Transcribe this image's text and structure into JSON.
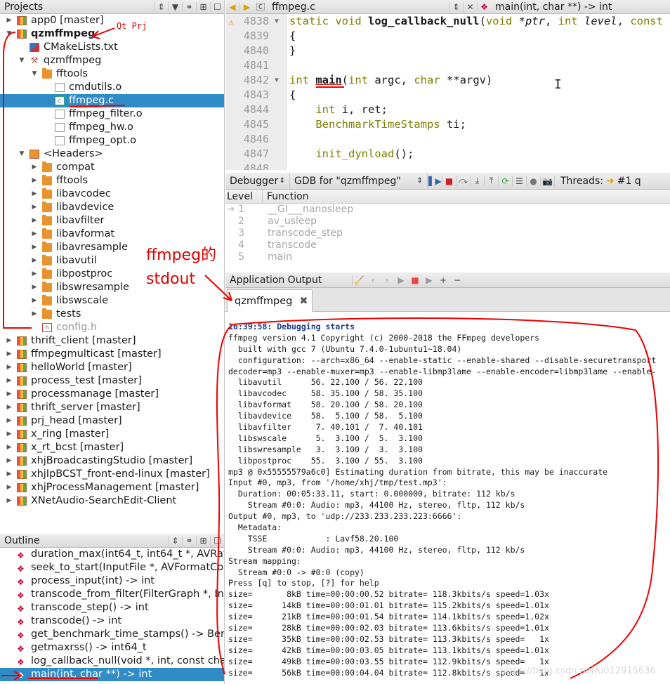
{
  "projects": {
    "title": "Projects",
    "items": [
      {
        "label": "app0 [master]",
        "kind": "proj",
        "lvl": 0,
        "arrow": "right"
      },
      {
        "label": "qzmffmpeg",
        "kind": "proj",
        "lvl": 0,
        "arrow": "down",
        "bold": true
      },
      {
        "label": "CMakeLists.txt",
        "kind": "cmake",
        "lvl": 1,
        "arrow": ""
      },
      {
        "label": "qzmffmpeg",
        "kind": "hammer",
        "lvl": 1,
        "arrow": "down"
      },
      {
        "label": "fftools",
        "kind": "folder",
        "lvl": 2,
        "arrow": "down"
      },
      {
        "label": "cmdutils.o",
        "kind": "file",
        "lvl": 3,
        "arrow": ""
      },
      {
        "label": "ffmpeg.c",
        "kind": "cfile",
        "lvl": 3,
        "arrow": "",
        "sel": true
      },
      {
        "label": "ffmpeg_filter.o",
        "kind": "file",
        "lvl": 3,
        "arrow": ""
      },
      {
        "label": "ffmpeg_hw.o",
        "kind": "file",
        "lvl": 3,
        "arrow": ""
      },
      {
        "label": "ffmpeg_opt.o",
        "kind": "file",
        "lvl": 3,
        "arrow": ""
      },
      {
        "label": "<Headers>",
        "kind": "hdrs",
        "lvl": 1,
        "arrow": "down"
      },
      {
        "label": "compat",
        "kind": "folder",
        "lvl": 2,
        "arrow": "right"
      },
      {
        "label": "fftools",
        "kind": "folder",
        "lvl": 2,
        "arrow": "right"
      },
      {
        "label": "libavcodec",
        "kind": "folder",
        "lvl": 2,
        "arrow": "right"
      },
      {
        "label": "libavdevice",
        "kind": "folder",
        "lvl": 2,
        "arrow": "right"
      },
      {
        "label": "libavfilter",
        "kind": "folder",
        "lvl": 2,
        "arrow": "right"
      },
      {
        "label": "libavformat",
        "kind": "folder",
        "lvl": 2,
        "arrow": "right"
      },
      {
        "label": "libavresample",
        "kind": "folder",
        "lvl": 2,
        "arrow": "right"
      },
      {
        "label": "libavutil",
        "kind": "folder",
        "lvl": 2,
        "arrow": "right"
      },
      {
        "label": "libpostproc",
        "kind": "folder",
        "lvl": 2,
        "arrow": "right"
      },
      {
        "label": "libswresample",
        "kind": "folder",
        "lvl": 2,
        "arrow": "right"
      },
      {
        "label": "libswscale",
        "kind": "folder",
        "lvl": 2,
        "arrow": "right"
      },
      {
        "label": "tests",
        "kind": "folder",
        "lvl": 2,
        "arrow": "right"
      },
      {
        "label": "config.h",
        "kind": "hfile",
        "lvl": 2,
        "arrow": "",
        "dim": true
      },
      {
        "label": "thrift_client [master]",
        "kind": "proj",
        "lvl": 0,
        "arrow": "right"
      },
      {
        "label": "ffmpegmulticast [master]",
        "kind": "proj",
        "lvl": 0,
        "arrow": "right"
      },
      {
        "label": "helloWorld [master]",
        "kind": "proj",
        "lvl": 0,
        "arrow": "right"
      },
      {
        "label": "process_test [master]",
        "kind": "proj",
        "lvl": 0,
        "arrow": "right"
      },
      {
        "label": "processmanage [master]",
        "kind": "proj",
        "lvl": 0,
        "arrow": "right"
      },
      {
        "label": "thrift_server [master]",
        "kind": "proj",
        "lvl": 0,
        "arrow": "right"
      },
      {
        "label": "prj_head [master]",
        "kind": "proj",
        "lvl": 0,
        "arrow": "right"
      },
      {
        "label": "x_ring [master]",
        "kind": "proj",
        "lvl": 0,
        "arrow": "right"
      },
      {
        "label": "x_rt_bcst [master]",
        "kind": "proj",
        "lvl": 0,
        "arrow": "right"
      },
      {
        "label": "xhjBroadcastingStudio [master]",
        "kind": "proj",
        "lvl": 0,
        "arrow": "right"
      },
      {
        "label": "xhjIpBCST_front-end-linux [master]",
        "kind": "proj",
        "lvl": 0,
        "arrow": "right"
      },
      {
        "label": "xhjProcessManagement [master]",
        "kind": "proj",
        "lvl": 0,
        "arrow": "right"
      },
      {
        "label": "XNetAudio-SearchEdit-Client",
        "kind": "proj",
        "lvl": 0,
        "arrow": "right"
      }
    ]
  },
  "outline": {
    "title": "Outline",
    "items": [
      {
        "label": "duration_max(int64_t, int64_t *, AVRat"
      },
      {
        "label": "seek_to_start(InputFile *, AVFormatCo"
      },
      {
        "label": "process_input(int) -> int"
      },
      {
        "label": "transcode_from_filter(FilterGraph *, In"
      },
      {
        "label": "transcode_step() -> int"
      },
      {
        "label": "transcode() -> int"
      },
      {
        "label": "get_benchmark_time_stamps() -> Benc"
      },
      {
        "label": "getmaxrss() -> int64_t"
      },
      {
        "label": "log_callback_null(void *, int, const char"
      },
      {
        "label": "main(int, char **) -> int",
        "sel": true
      }
    ]
  },
  "editor": {
    "file": "ffmpeg.c",
    "symbol": "main(int, char **) -> int",
    "lines": [
      {
        "n": "4838",
        "fold": "▼",
        "warn": true,
        "segs": [
          {
            "c": "kw",
            "t": "static void "
          },
          {
            "c": "fn",
            "t": "log_callback_null"
          },
          {
            "c": "",
            "t": "("
          },
          {
            "c": "kw",
            "t": "void"
          },
          {
            "c": "",
            "t": " *"
          },
          {
            "c": "pr",
            "t": "ptr"
          },
          {
            "c": "",
            "t": ", "
          },
          {
            "c": "kw",
            "t": "int"
          },
          {
            "c": "",
            "t": " "
          },
          {
            "c": "pr",
            "t": "level"
          },
          {
            "c": "",
            "t": ", "
          },
          {
            "c": "kw",
            "t": "const"
          }
        ]
      },
      {
        "n": "4839",
        "segs": [
          {
            "c": "",
            "t": "{"
          }
        ]
      },
      {
        "n": "4840",
        "segs": [
          {
            "c": "",
            "t": "}"
          }
        ]
      },
      {
        "n": "4841",
        "segs": []
      },
      {
        "n": "4842",
        "fold": "▼",
        "segs": [
          {
            "c": "kw",
            "t": "int "
          },
          {
            "c": "fn mu",
            "t": "main"
          },
          {
            "c": "",
            "t": "("
          },
          {
            "c": "kw",
            "t": "int"
          },
          {
            "c": "",
            "t": " argc, "
          },
          {
            "c": "kw",
            "t": "char"
          },
          {
            "c": "",
            "t": " **argv)"
          }
        ]
      },
      {
        "n": "4843",
        "segs": [
          {
            "c": "",
            "t": "{"
          }
        ]
      },
      {
        "n": "4844",
        "segs": [
          {
            "c": "",
            "t": "    "
          },
          {
            "c": "kw",
            "t": "int"
          },
          {
            "c": "",
            "t": " i, ret;"
          }
        ]
      },
      {
        "n": "4845",
        "segs": [
          {
            "c": "",
            "t": "    "
          },
          {
            "c": "kw",
            "t": "BenchmarkTimeStamps"
          },
          {
            "c": "",
            "t": " ti;"
          }
        ]
      },
      {
        "n": "4846",
        "segs": []
      },
      {
        "n": "4847",
        "segs": [
          {
            "c": "",
            "t": "    "
          },
          {
            "c": "kw",
            "t": "init_dynload"
          },
          {
            "c": "",
            "t": "();"
          }
        ]
      },
      {
        "n": "4848",
        "segs": []
      }
    ]
  },
  "debugger": {
    "mode": "Debugger",
    "config": "GDB for \"qzmffmpeg\"",
    "threads_label": "Threads:",
    "thread": "#1 q",
    "col_level": "Level",
    "col_function": "Function",
    "frames": [
      {
        "level": "1",
        "fn": "__GI___nanosleep"
      },
      {
        "level": "2",
        "fn": "av_usleep"
      },
      {
        "level": "3",
        "fn": "transcode_step"
      },
      {
        "level": "4",
        "fn": "transcode"
      },
      {
        "level": "5",
        "fn": "main"
      }
    ]
  },
  "app_output": {
    "title": "Application Output",
    "tab": "qzmffmpeg",
    "lines": [
      "16:39:58: Debugging starts",
      "ffmpeg version 4.1 Copyright (c) 2000-2018 the FFmpeg developers",
      "  built with gcc 7 (Ubuntu 7.4.0-1ubuntu1~18.04)",
      "  configuration: --arch=x86_64 --enable-static --enable-shared --disable-securetransport",
      "decoder=mp3 --enable-muxer=mp3 --enable-libmp3lame --enable-encoder=libmp3lame --enable-",
      "  libavutil      56. 22.100 / 56. 22.100",
      "  libavcodec     58. 35.100 / 58. 35.100",
      "  libavformat    58. 20.100 / 58. 20.100",
      "  libavdevice    58.  5.100 / 58.  5.100",
      "  libavfilter     7. 40.101 /  7. 40.101",
      "  libswscale      5.  3.100 /  5.  3.100",
      "  libswresample   3.  3.100 /  3.  3.100",
      "  libpostproc    55.  3.100 / 55.  3.100",
      "mp3 @ 0x55555579a6c0] Estimating duration from bitrate, this may be inaccurate",
      "Input #0, mp3, from '/home/xhj/tmp/test.mp3':",
      "  Duration: 00:05:33.11, start: 0.000000, bitrate: 112 kb/s",
      "    Stream #0:0: Audio: mp3, 44100 Hz, stereo, fltp, 112 kb/s",
      "Output #0, mp3, to 'udp://233.233.233.223:6666':",
      "  Metadata:",
      "    TSSE            : Lavf58.20.100",
      "    Stream #0:0: Audio: mp3, 44100 Hz, stereo, fltp, 112 kb/s",
      "Stream mapping:",
      "  Stream #0:0 -> #0:0 (copy)",
      "Press [q] to stop, [?] for help",
      "size=       8kB time=00:00:00.52 bitrate= 118.3kbits/s speed=1.03x",
      "size=      14kB time=00:00:01.01 bitrate= 115.2kbits/s speed=1.01x",
      "size=      21kB time=00:00:01.54 bitrate= 114.1kbits/s speed=1.02x",
      "size=      28kB time=00:00:02.03 bitrate= 113.6kbits/s speed=1.01x",
      "size=      35kB time=00:00:02.53 bitrate= 113.3kbits/s speed=   1x",
      "size=      42kB time=00:00:03.05 bitrate= 113.1kbits/s speed=1.01x",
      "size=      49kB time=00:00:03.55 bitrate= 112.9kbits/s speed=   1x",
      "size=      56kB time=00:00:04.04 bitrate= 112.8kbits/s speed=   1x"
    ]
  },
  "annotations": {
    "qt_prj": "Qt Prj",
    "stdout_1": "ffmpeg的",
    "stdout_2": "stdout",
    "watermark": "https://blog.csdn.net/u012915636"
  }
}
